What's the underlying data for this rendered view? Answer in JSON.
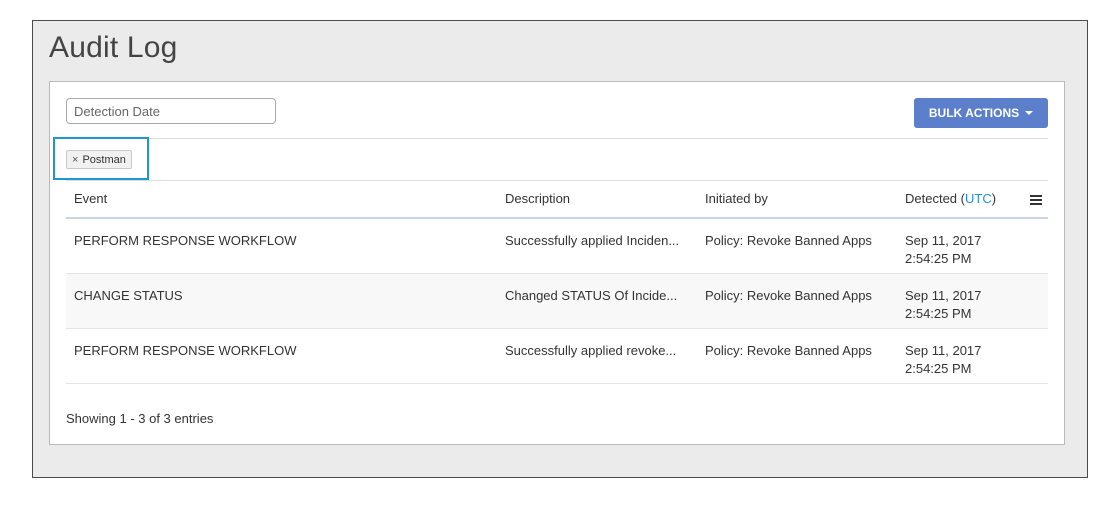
{
  "page": {
    "title": "Audit Log"
  },
  "filters": {
    "date_placeholder": "Detection Date",
    "bulk_actions_label": "BULK ACTIONS",
    "active_chip": "Postman",
    "chip_remove": "×"
  },
  "table": {
    "headers": {
      "event": "Event",
      "description": "Description",
      "initiated_by": "Initiated by",
      "detected": "Detected (",
      "detected_tz": "UTC",
      "detected_close": ")"
    },
    "rows": [
      {
        "event": "PERFORM RESPONSE WORKFLOW",
        "description": "Successfully applied Inciden...",
        "initiated_by": "Policy: Revoke Banned Apps",
        "date": "Sep 11, 2017",
        "time": "2:54:25 PM"
      },
      {
        "event": "CHANGE STATUS",
        "description": "Changed STATUS Of Incide...",
        "initiated_by": "Policy: Revoke Banned Apps",
        "date": "Sep 11, 2017",
        "time": "2:54:25 PM"
      },
      {
        "event": "PERFORM RESPONSE WORKFLOW",
        "description": "Successfully applied revoke...",
        "initiated_by": "Policy: Revoke Banned Apps",
        "date": "Sep 11, 2017",
        "time": "2:54:25 PM"
      }
    ]
  },
  "footer": {
    "entries_text": "Showing 1 - 3 of 3 entries"
  },
  "colors": {
    "accent": "#5b7fcb",
    "highlight": "#1c97cf",
    "link": "#2a8fd0"
  }
}
